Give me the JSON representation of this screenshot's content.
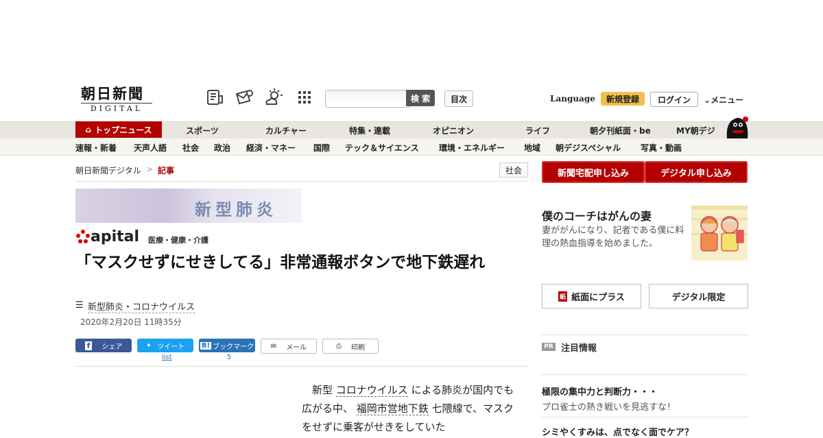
{
  "header": {
    "logo_main": "朝日新聞",
    "logo_sub": "DIGITAL",
    "search_button": "検 索",
    "search_placeholder": "",
    "index_button": "目次",
    "language": "Language",
    "register": "新規登録",
    "login": "ログイン",
    "menu": "メニュー",
    "icons": [
      "newspaper-icon",
      "mail-icon",
      "weather-icon",
      "grid-icon"
    ]
  },
  "nav_primary": {
    "active": "トップニュース",
    "items": [
      "スポーツ",
      "カルチャー",
      "特集・連載",
      "オピニオン",
      "ライフ",
      "朝夕刊紙面・be",
      "MY朝デジ"
    ]
  },
  "nav_secondary": [
    "速報・新着",
    "天声人語",
    "社会",
    "政治",
    "経済・マネー",
    "国際",
    "テック＆サイエンス",
    "環境・エネルギー",
    "地域",
    "朝デジスペシャル",
    "写真・動画"
  ],
  "breadcrumb": {
    "home": "朝日新聞デジタル",
    "separator": ">",
    "current": "記事",
    "section": "社会"
  },
  "banner": {
    "text": "新型肺炎"
  },
  "apital": {
    "logo": "apital",
    "sub": "医療・健康・介護"
  },
  "article": {
    "headline": "「マスクせずにせきしてる」非常通報ボタンで地下鉄遅れ",
    "tag": "新型肺炎・コロナウイルス",
    "date": "2020年2月20日 11時35分",
    "body_parts": [
      "新型 ",
      "コロナウイルス",
      " による肺炎が国内でも広がる中、 ",
      "福岡市営地下鉄",
      " 七隈線で、マスクをせずに乗客がせきをしていた"
    ]
  },
  "share": {
    "facebook": "シェア",
    "twitter": "ツイート",
    "twitter_count": "list",
    "hatena": "ブックマーク",
    "hatena_count": "5",
    "mail": "メール",
    "print": "印刷"
  },
  "sidebar": {
    "subscribe_paper": "新聞宅配申し込み",
    "subscribe_digital": "デジタル申し込み",
    "promo_title": "僕のコーチはがんの妻",
    "promo_text": "妻ががんになり、記者である僕に料理の熱血指導を始めました。",
    "btn_paper_plus": "紙面にプラス",
    "btn_digital_only": "デジタル限定",
    "pr_badge": "PR",
    "pr_title": "注目情報",
    "pr_items": [
      {
        "title": "極限の集中力と判断力・・・",
        "text": "プロ雀士の熱き戦いを見逃すな！"
      },
      {
        "title": "シミやくすみは、点でなく面でケア？"
      }
    ]
  },
  "colors": {
    "brand_red": "#b30000",
    "facebook": "#3b5998",
    "twitter": "#1da1f2",
    "hatena": "#2a73b8",
    "register": "#f0c14b"
  }
}
